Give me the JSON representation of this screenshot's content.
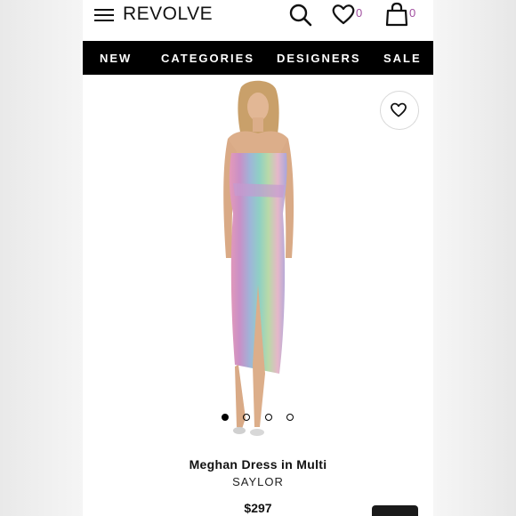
{
  "header": {
    "logo": "REVOLVE",
    "wishlist_count": "0",
    "bag_count": "0"
  },
  "nav": {
    "items": [
      "NEW",
      "CATEGORIES",
      "DESIGNERS",
      "SALE"
    ]
  },
  "product": {
    "title": "Meghan Dress in Multi",
    "brand": "SAYLOR",
    "price": "$297",
    "image_dots": {
      "total": 4,
      "active": 1
    }
  },
  "colors": {
    "nav_bg": "#000000",
    "badge_accent": "#a14fa0",
    "dress_stripes": [
      "#e59ab8",
      "#c98fc7",
      "#9fb5d8",
      "#8fd0c4",
      "#b9d9a8",
      "#e6b7c9"
    ]
  },
  "icons": [
    "hamburger-icon",
    "search-icon",
    "heart-icon",
    "shopping-bag-icon",
    "heart-outline-icon"
  ]
}
